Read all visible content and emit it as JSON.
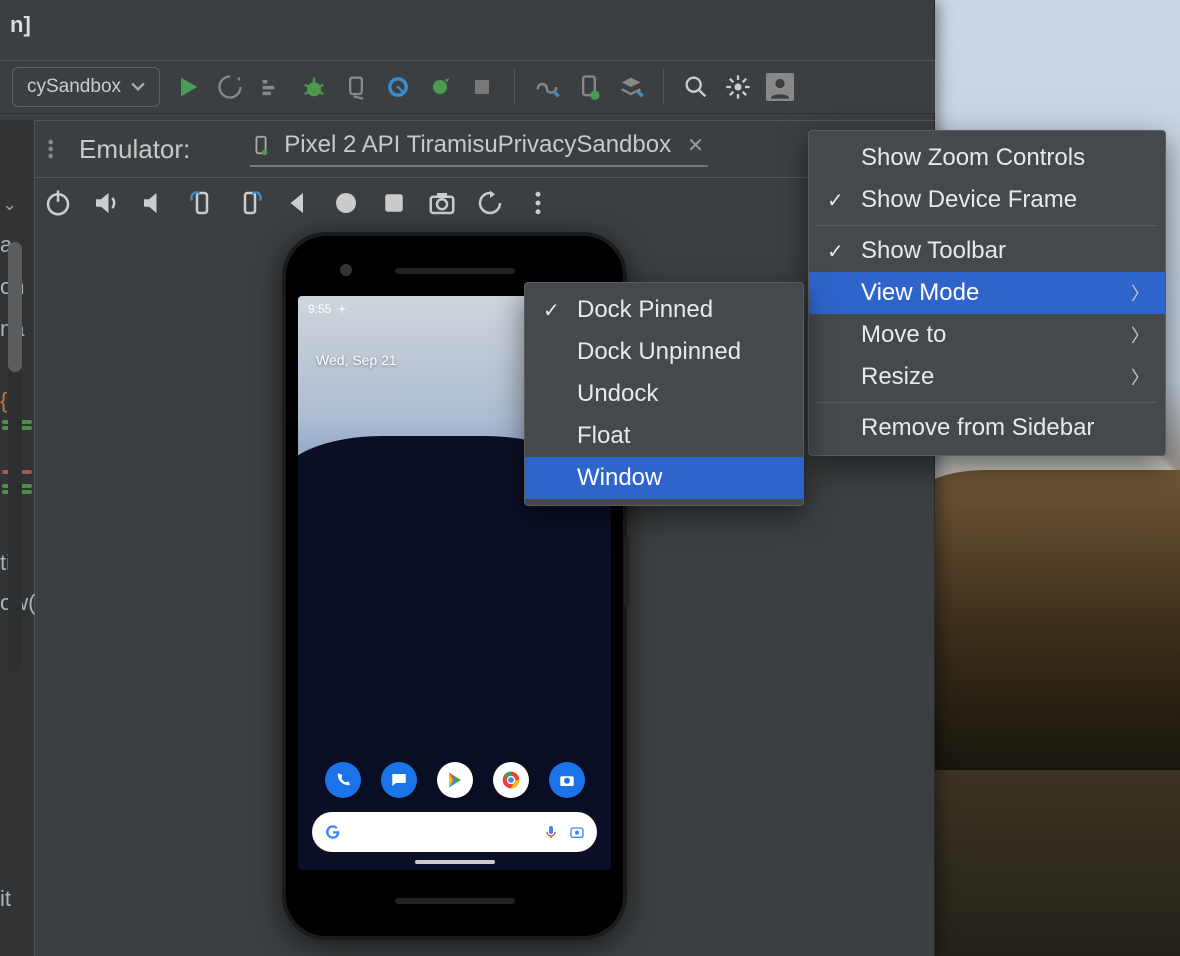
{
  "titlebar_suffix": "n]",
  "run_config": {
    "label": "cySandbox"
  },
  "toolbar_icons": [
    "run",
    "coverage",
    "profile",
    "debug",
    "attach",
    "inspect",
    "android",
    "stop",
    "sync",
    "device-manager",
    "sdk",
    "search",
    "settings",
    "account"
  ],
  "emulator": {
    "label": "Emulator:",
    "tab": {
      "name": "Pixel 2 API TiramisuPrivacySandbox"
    },
    "controls": [
      "power",
      "volume-up",
      "volume-down",
      "rotate-left",
      "rotate-right",
      "back",
      "home",
      "overview",
      "screenshot",
      "snapshot",
      "more"
    ]
  },
  "phone": {
    "status_time": "9:55",
    "date_widget": "Wed, Sep 21",
    "dock": [
      "phone",
      "messages",
      "play",
      "chrome",
      "camera"
    ]
  },
  "menu_primary": {
    "items": [
      {
        "label": "Show Zoom Controls",
        "checked": false,
        "submenu": false,
        "selected": false
      },
      {
        "label": "Show Device Frame",
        "checked": true,
        "submenu": false,
        "selected": false
      },
      {
        "sep": true
      },
      {
        "label": "Show Toolbar",
        "checked": true,
        "submenu": false,
        "selected": false
      },
      {
        "label": "View Mode",
        "checked": false,
        "submenu": true,
        "selected": true
      },
      {
        "label": "Move to",
        "checked": false,
        "submenu": true,
        "selected": false
      },
      {
        "label": "Resize",
        "checked": false,
        "submenu": true,
        "selected": false
      },
      {
        "sep": true
      },
      {
        "label": "Remove from Sidebar",
        "checked": false,
        "submenu": false,
        "selected": false
      }
    ]
  },
  "menu_sub": {
    "items": [
      {
        "label": "Dock Pinned",
        "checked": true,
        "selected": false
      },
      {
        "label": "Dock Unpinned",
        "checked": false,
        "selected": false
      },
      {
        "label": "Undock",
        "checked": false,
        "selected": false
      },
      {
        "label": "Float",
        "checked": false,
        "selected": false
      },
      {
        "label": "Window",
        "checked": false,
        "selected": true
      }
    ]
  },
  "left_text": {
    "a": "a",
    "on": "on",
    "na": "na",
    "brace": "{",
    "ti": "ti",
    "ow": "ow(",
    "it": "it"
  }
}
